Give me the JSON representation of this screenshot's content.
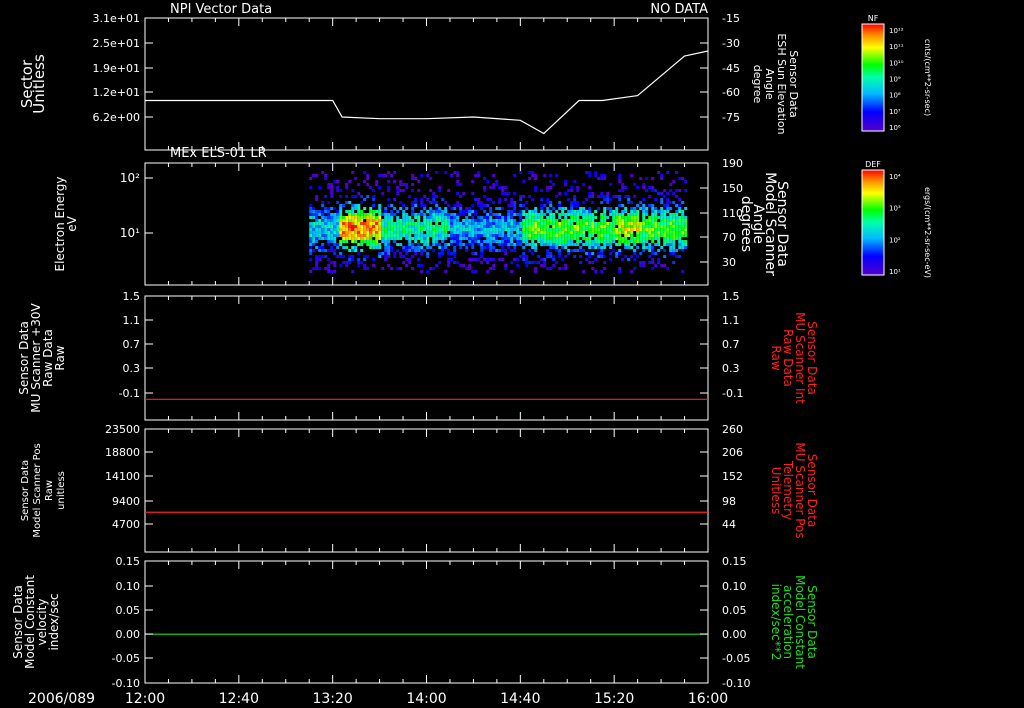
{
  "date_label": "2006/089",
  "x_ticks": [
    "12:00",
    "12:40",
    "13:20",
    "14:00",
    "14:40",
    "15:20",
    "16:00"
  ],
  "panels": [
    {
      "id": "npi",
      "title": "NPI Vector Data",
      "right_title": "NO DATA",
      "left_label": [
        "Sector",
        "Unitless"
      ],
      "left_ticks": [
        "3.1e+01",
        "2.5e+01",
        "1.9e+01",
        "1.2e+01",
        "6.2e+00"
      ],
      "right_label": [
        "Sensor Data",
        "ESH Sun Elevation",
        "Angle",
        "degree"
      ],
      "right_ticks": [
        "-15",
        "-30",
        "-45",
        "-60",
        "-75"
      ],
      "line_color": "#ffffff"
    },
    {
      "id": "els",
      "title": "MEx ELS-01 LR",
      "left_label": [
        "Electron Energy",
        "eV"
      ],
      "left_ticks": [
        "10²",
        "10¹"
      ],
      "right_label": [
        "Sensor Data",
        "Model Scanner",
        "Angle",
        "degrees"
      ],
      "right_ticks": [
        "190",
        "150",
        "110",
        "70",
        "30"
      ]
    },
    {
      "id": "mu_raw",
      "left_label": [
        "Sensor Data",
        "MU Scanner +30V",
        "Raw Data",
        "Raw"
      ],
      "left_ticks": [
        "1.5",
        "1.1",
        "0.7",
        "0.3",
        "-0.1"
      ],
      "right_label": [
        "Sensor Data",
        "MU Scanner Int",
        "Raw Data",
        "Raw"
      ],
      "right_ticks": [
        "1.5",
        "1.1",
        "0.7",
        "0.3",
        "-0.1"
      ],
      "right_label_color": "#ff2020",
      "line_color": "#ff2020"
    },
    {
      "id": "scanner_pos",
      "left_label": [
        "Sensor Data",
        "Model Scanner Pos",
        "Raw",
        "unitless"
      ],
      "left_ticks": [
        "23500",
        "18800",
        "14100",
        "9400",
        "4700"
      ],
      "right_label": [
        "Sensor Data",
        "MU Scanner Pos",
        "Telemetry",
        "Unitless"
      ],
      "right_ticks": [
        "260",
        "206",
        "152",
        "98",
        "44"
      ],
      "right_label_color": "#ff2020",
      "line_color": "#ff2020"
    },
    {
      "id": "constant",
      "left_label": [
        "Sensor Data",
        "Model Constant",
        "velocity",
        "index/sec"
      ],
      "left_ticks": [
        "0.15",
        "0.10",
        "0.05",
        "0.00",
        "-0.05",
        "-0.10"
      ],
      "right_label": [
        "Sensor Data",
        "Model Constant",
        "acceleration",
        "index/sec**2"
      ],
      "right_ticks": [
        "0.15",
        "0.10",
        "0.05",
        "0.00",
        "-0.05",
        "-0.10"
      ],
      "right_label_color": "#22dd22",
      "line_color": "#22dd22"
    }
  ],
  "colorbars": [
    {
      "id": "nf",
      "label": "NF",
      "ticks": [
        "10¹²",
        "10¹¹",
        "10¹⁰",
        "10⁹",
        "10⁸",
        "10⁷",
        "10⁶"
      ],
      "unit": "cnts/(cm**2-sr-sec)"
    },
    {
      "id": "def",
      "label": "DEF",
      "ticks": [
        "10⁴",
        "10³",
        "10²",
        "10¹"
      ],
      "unit": "ergs/(cm**2-sr-sec-eV)"
    }
  ],
  "chart_data": [
    {
      "type": "line",
      "title": "NPI Vector Data",
      "x": [
        "12:00",
        "12:40",
        "13:00",
        "13:20",
        "13:24",
        "13:40",
        "14:00",
        "14:20",
        "14:40",
        "14:50",
        "14:56",
        "15:05",
        "15:15",
        "15:30",
        "15:40",
        "15:50",
        "16:00"
      ],
      "series": [
        {
          "name": "ESH Sun Elevation Angle",
          "values": [
            -60,
            -60,
            -60,
            -60,
            -70,
            -71,
            -71,
            -70,
            -72,
            -80,
            -72,
            -60,
            -60,
            -57,
            -45,
            -33,
            -30
          ]
        }
      ],
      "xlabel": "",
      "ylabel": "Sector Unitless",
      "y2label": "ESH Sun Elevation Angle degree",
      "ylim": [
        -90,
        -10
      ]
    },
    {
      "type": "heatmap",
      "title": "MEx ELS-01 LR",
      "x_range": [
        "13:10",
        "15:50"
      ],
      "ylabel": "Electron Energy eV",
      "yscale": "log",
      "ylim": [
        1,
        200
      ],
      "colorbar": "DEF ergs/(cm**2-sr-sec-eV)",
      "intensity_profile": [
        {
          "start": "13:10",
          "end": "13:22",
          "level": 0.35
        },
        {
          "start": "13:22",
          "end": "13:40",
          "level": 0.85
        },
        {
          "start": "13:40",
          "end": "14:10",
          "level": 0.45
        },
        {
          "start": "14:10",
          "end": "14:40",
          "level": 0.3
        },
        {
          "start": "14:40",
          "end": "15:20",
          "level": 0.6
        },
        {
          "start": "15:20",
          "end": "15:30",
          "level": 0.7
        },
        {
          "start": "15:30",
          "end": "15:50",
          "level": 0.6
        }
      ]
    },
    {
      "type": "line",
      "x": [
        "12:00",
        "16:00"
      ],
      "series": [
        {
          "name": "MU Scanner Int Raw Data",
          "values": [
            0.0,
            0.0
          ]
        }
      ],
      "ylim": [
        -0.3,
        1.5
      ]
    },
    {
      "type": "line",
      "x": [
        "12:00",
        "16:00"
      ],
      "series": [
        {
          "name": "Model Scanner Pos Raw",
          "values": [
            7600,
            7600
          ]
        }
      ],
      "ylim": [
        0,
        23500
      ]
    },
    {
      "type": "line",
      "x": [
        "12:00",
        "16:00"
      ],
      "series": [
        {
          "name": "Model Constant velocity",
          "values": [
            0.0,
            0.0
          ]
        }
      ],
      "ylim": [
        -0.1,
        0.15
      ]
    }
  ]
}
